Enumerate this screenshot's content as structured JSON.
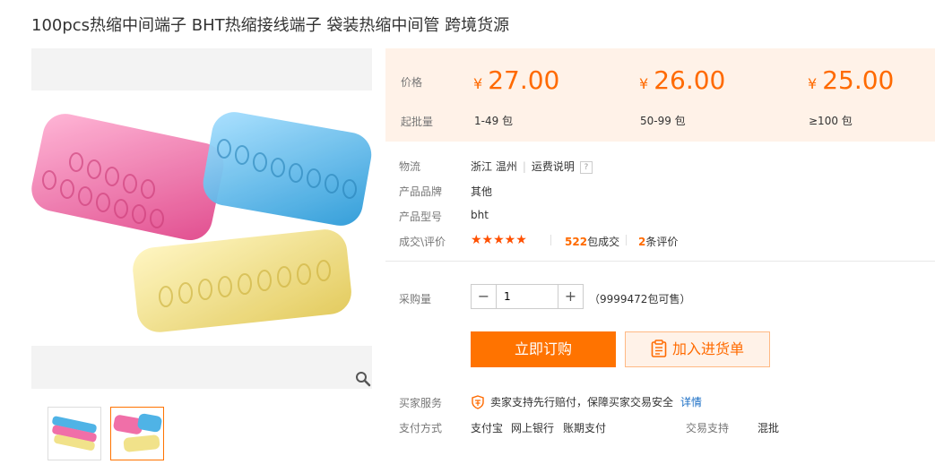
{
  "product": {
    "title": "100pcs热缩中间端子 BHT热缩接线端子 袋装热缩中间管 跨境货源"
  },
  "price_panel": {
    "price_label": "价格",
    "moq_label": "起批量",
    "currency": "¥",
    "tiers": [
      {
        "price": "27.00",
        "qty": "1-49 包"
      },
      {
        "price": "26.00",
        "qty": "50-99 包"
      },
      {
        "price": "25.00",
        "qty": "≥100 包"
      }
    ]
  },
  "details": {
    "logistics_label": "物流",
    "logistics_location": "浙江 温州",
    "shipping_info": "运费说明",
    "help_glyph": "?",
    "brand_label": "产品品牌",
    "brand_value": "其他",
    "model_label": "产品型号",
    "model_value": "bht",
    "rating_label": "成交\\评价",
    "stars": "★★★★★",
    "deals_count": "522",
    "deals_suffix": "包成交",
    "reviews_count": "2",
    "reviews_suffix": "条评价"
  },
  "purchase": {
    "qty_label": "采购量",
    "minus": "−",
    "plus": "+",
    "qty_value": "1",
    "stock": "（9999472包可售）",
    "buy_now": "立即订购",
    "add_to_list": "加入进货单"
  },
  "services": {
    "buyer_service_label": "买家服务",
    "buyer_service_text": "卖家支持先行赔付，保障买家交易安全",
    "details_link": "详情",
    "payment_label": "支付方式",
    "payment_methods": [
      "支付宝",
      "网上银行",
      "账期支付"
    ],
    "trade_support_label": "交易支持",
    "trade_support_value": "混批"
  },
  "colors": {
    "accent": "#ff6a00",
    "buy_button": "#ff7300",
    "price_bg": "#fff2e8",
    "pink": "#f06fa8",
    "blue": "#4fb3e6",
    "yellow": "#f1e28a"
  }
}
